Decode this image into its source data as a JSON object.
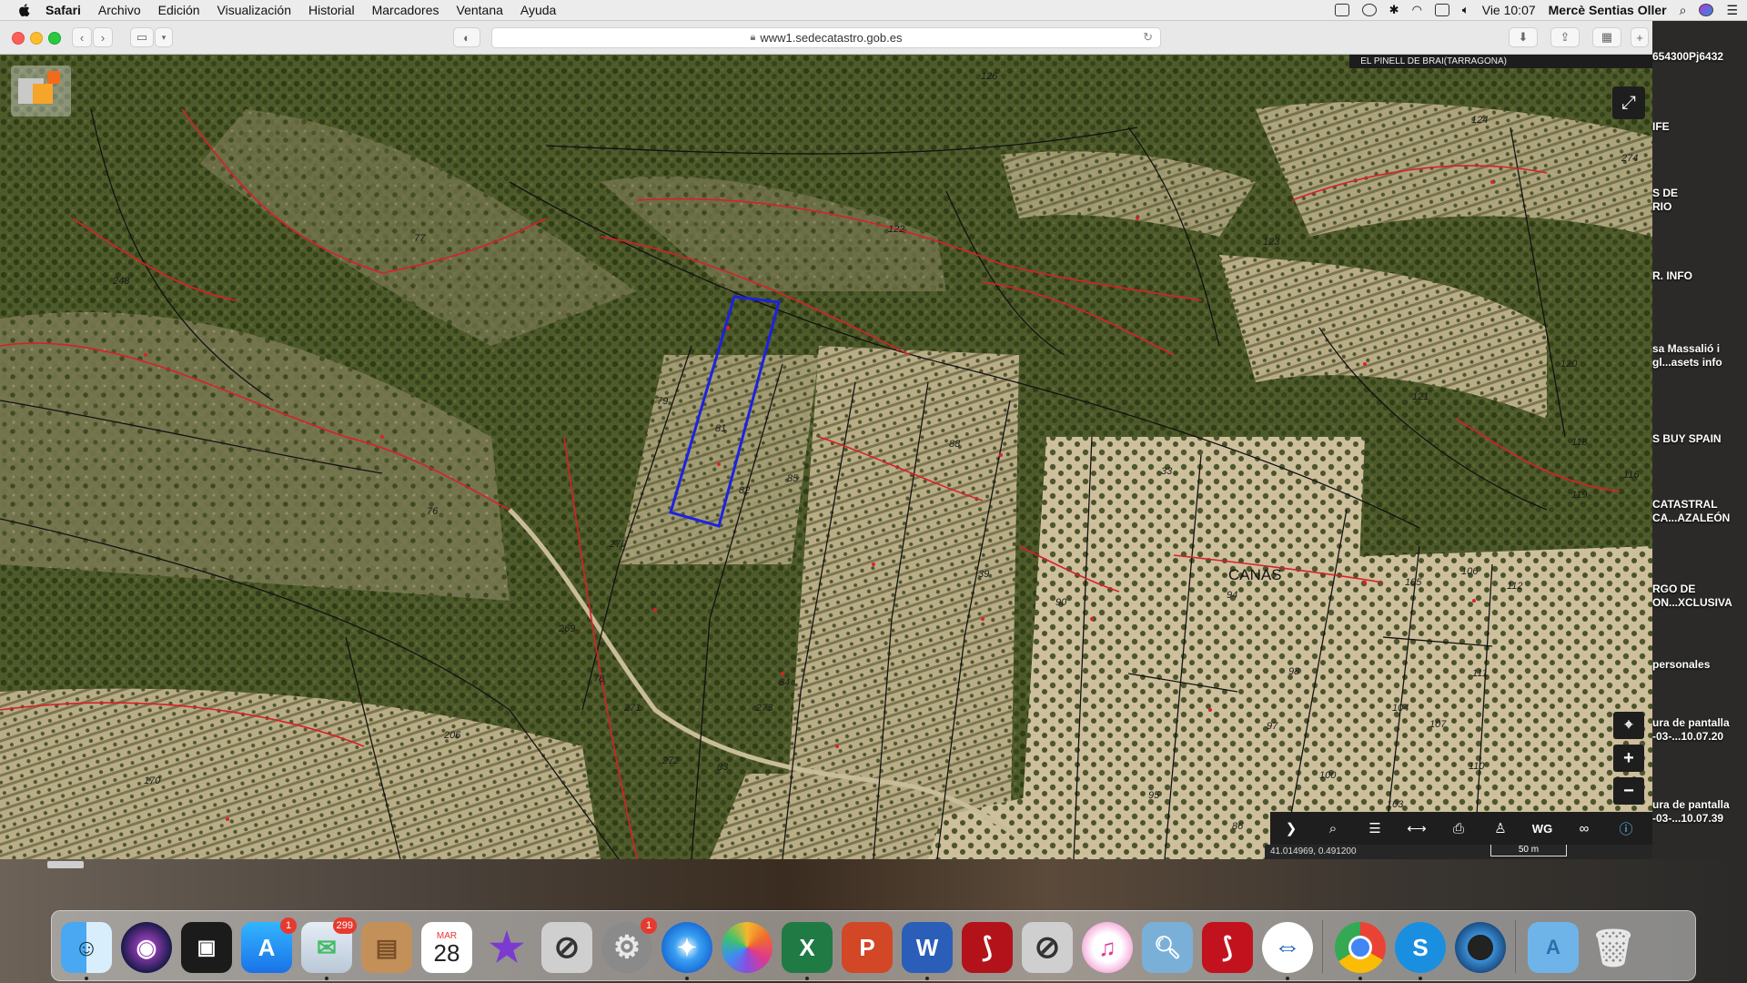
{
  "menubar": {
    "app_name": "Safari",
    "menus": [
      "Archivo",
      "Edición",
      "Visualización",
      "Historial",
      "Marcadores",
      "Ventana",
      "Ayuda"
    ],
    "clock": "Vie 10:07",
    "user": "Mercè Sentias Oller"
  },
  "browser": {
    "url": "www1.sedecatastro.gob.es"
  },
  "map": {
    "location_banner": "EL PINELL DE BRAI(TARRAGONA)",
    "coordinates": "41.014969, 0.491200",
    "scale_label": "50 m",
    "zone_label": "CANAS",
    "parcel_labels": [
      "126",
      "124",
      "274",
      "77",
      "122",
      "123",
      "248",
      "79",
      "81",
      "82",
      "85",
      "88",
      "120",
      "121",
      "116",
      "118",
      "119",
      "76",
      "270",
      "33",
      "39",
      "90",
      "94",
      "98",
      "105",
      "106",
      "112",
      "269",
      "78",
      "271",
      "273",
      "84",
      "206",
      "272",
      "83",
      "97",
      "104",
      "107",
      "111",
      "110",
      "100",
      "103",
      "95",
      "86",
      "170"
    ],
    "toolbar_icons": [
      "chevron-right-icon",
      "search-icon",
      "layers-icon",
      "measure-icon",
      "print-icon",
      "pegman-icon",
      "wms-icon",
      "binoculars-icon",
      "info-icon"
    ],
    "wms_label": "WG"
  },
  "desktop": {
    "top_label": "654300Pj6432",
    "items": [
      "IFE",
      "S DE\nRIO",
      "R. INFO",
      "sa Massalió i\ngl...asets info",
      "S BUY SPAIN",
      "CATASTRAL\nCA...AZALEÓN",
      "RGO DE\nON...XCLUSIVA",
      "personales",
      "ura de pantalla\n-03-...10.07.20",
      "ura de pantalla\n-03-...10.07.39"
    ]
  },
  "dock": {
    "badges": {
      "appstore": "1",
      "mail": "299",
      "sysprefs": "1"
    },
    "calendar_month": "MAR",
    "calendar_day": "28",
    "word_letter": "W",
    "excel_letter": "X",
    "ppt_letter": "P",
    "s_letter": "S"
  }
}
